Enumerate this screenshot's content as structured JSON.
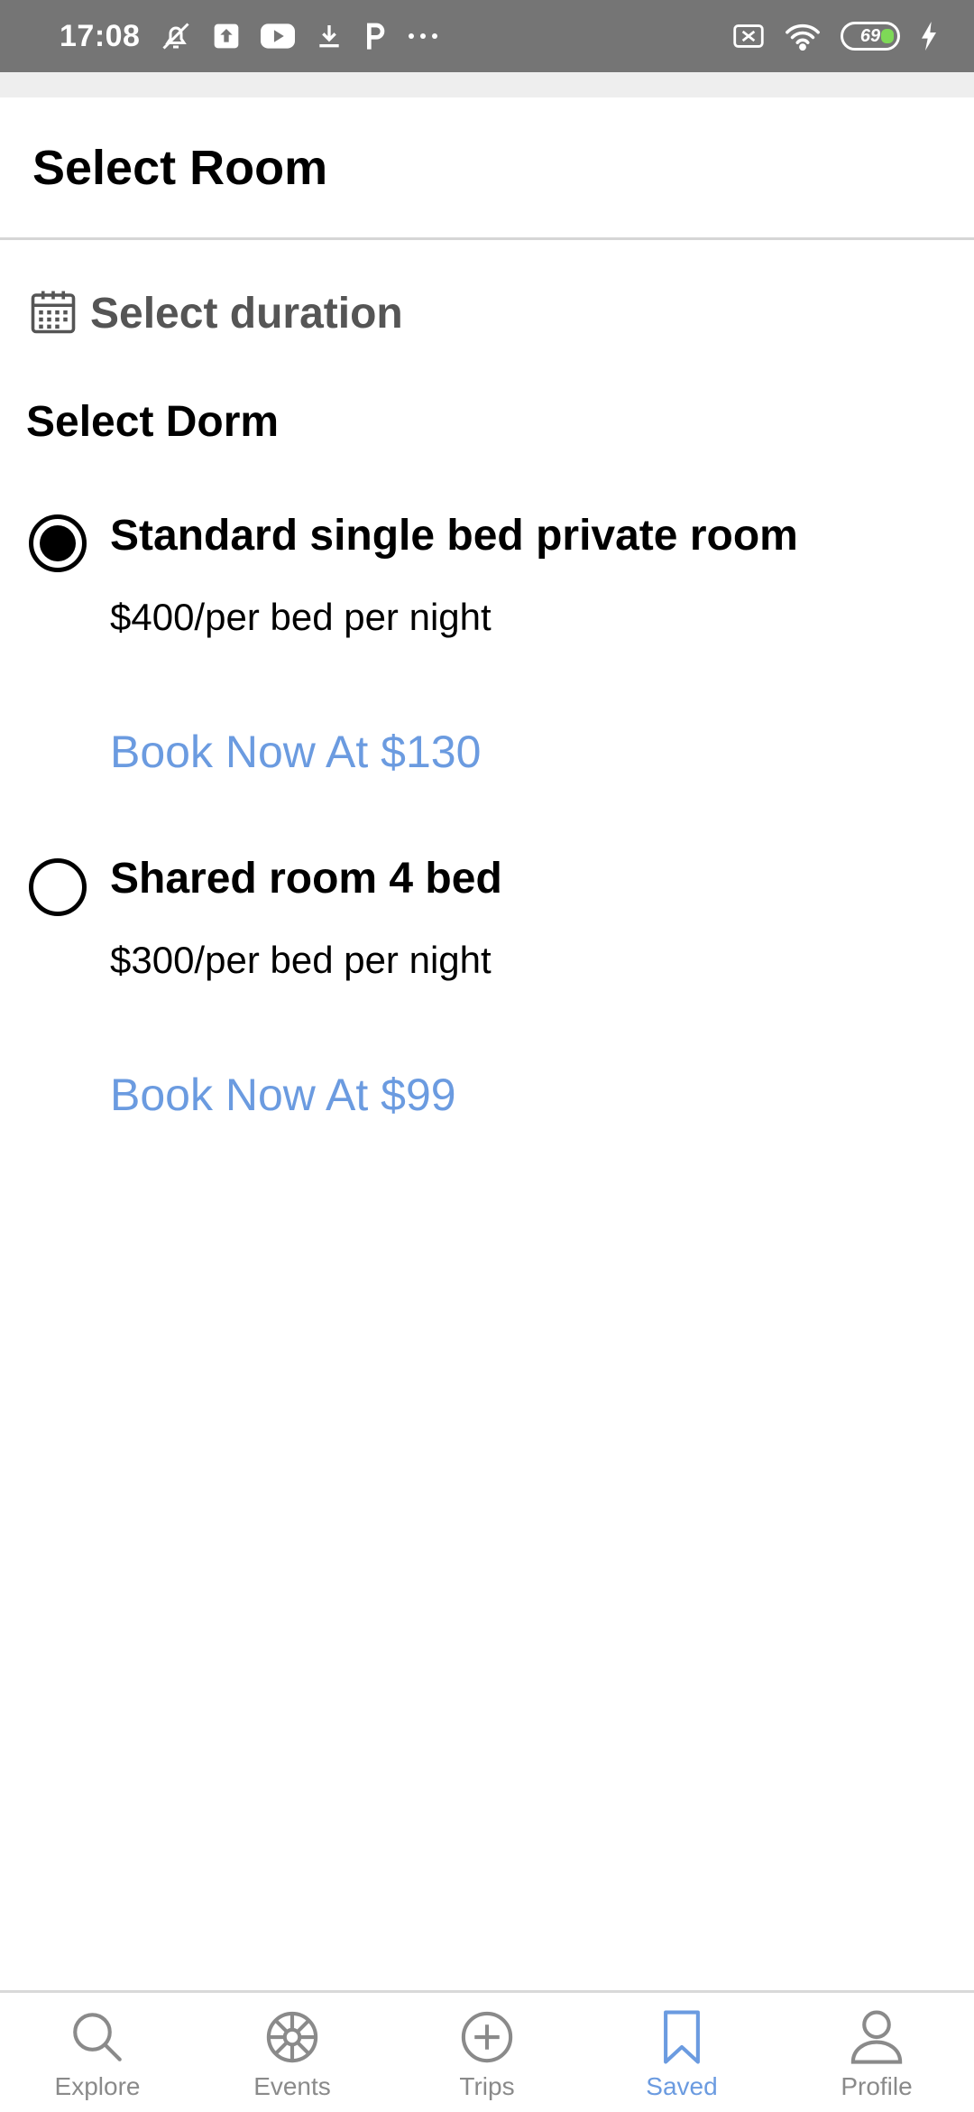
{
  "status_bar": {
    "time": "17:08",
    "battery": "69",
    "icons_left": [
      "mute-bell-icon",
      "upload-icon",
      "youtube-icon",
      "download-icon",
      "p-icon",
      "more-dots-icon"
    ],
    "icons_right": [
      "no-sim-icon",
      "wifi-icon",
      "battery-icon",
      "charging-icon"
    ]
  },
  "header": {
    "title": "Select Room"
  },
  "duration": {
    "label": "Select duration",
    "icon": "calendar-icon"
  },
  "dorm": {
    "title": "Select Dorm",
    "options": [
      {
        "name": "Standard single bed private room",
        "price": "$400/per bed per night",
        "book_label": "Book Now At $130",
        "selected": true
      },
      {
        "name": "Shared room 4 bed",
        "price": "$300/per bed per night",
        "book_label": "Book Now At $99",
        "selected": false
      }
    ]
  },
  "nav": {
    "active_color": "#6b9be0",
    "inactive_color": "#8a8a8a",
    "items": [
      {
        "label": "Explore",
        "icon": "search-icon",
        "active": false
      },
      {
        "label": "Events",
        "icon": "wheel-icon",
        "active": false
      },
      {
        "label": "Trips",
        "icon": "plus-circle-icon",
        "active": false
      },
      {
        "label": "Saved",
        "icon": "bookmark-icon",
        "active": true
      },
      {
        "label": "Profile",
        "icon": "person-icon",
        "active": false
      }
    ]
  }
}
